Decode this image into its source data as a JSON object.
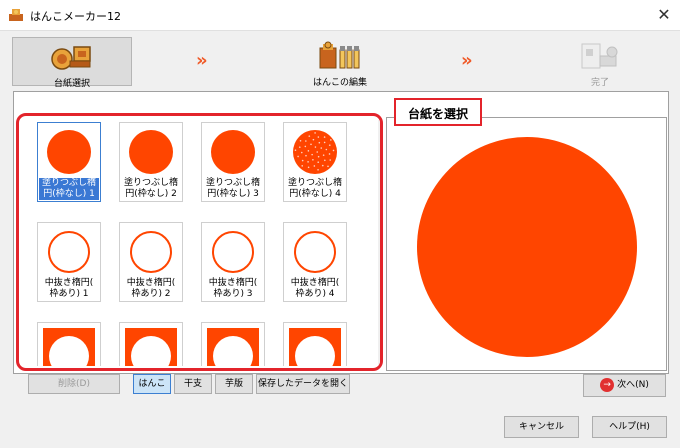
{
  "window": {
    "title": "はんこメーカー12",
    "close_glyph": "✕"
  },
  "steps": [
    {
      "label": "台紙選択",
      "icon": "stamp-base-icon",
      "active": true
    },
    {
      "label": "はんこの編集",
      "icon": "stamp-edit-icon",
      "active": false
    },
    {
      "label": "完了",
      "icon": "finish-icon",
      "active": false
    }
  ],
  "arrows": "»",
  "grid": {
    "items": [
      {
        "label": "塗りつぶし楕\n円(枠なし) 1",
        "style": "solid",
        "selected": true
      },
      {
        "label": "塗りつぶし楕\n円(枠なし) 2",
        "style": "solid",
        "selected": false
      },
      {
        "label": "塗りつぶし楕\n円(枠なし) 3",
        "style": "solid",
        "selected": false
      },
      {
        "label": "塗りつぶし楕\n円(枠なし) 4",
        "style": "speckled",
        "selected": false
      },
      {
        "label": "中抜き楕円(\n枠あり) 1",
        "style": "ring",
        "selected": false
      },
      {
        "label": "中抜き楕円(\n枠あり) 2",
        "style": "ring",
        "selected": false
      },
      {
        "label": "中抜き楕円(\n枠あり) 3",
        "style": "ring",
        "selected": false
      },
      {
        "label": "中抜き楕円(\n枠あり) 4",
        "style": "ring",
        "selected": false
      },
      {
        "label": "",
        "style": "square-hole",
        "selected": false
      },
      {
        "label": "",
        "style": "square-hole",
        "selected": false
      },
      {
        "label": "",
        "style": "square-hole",
        "selected": false
      },
      {
        "label": "",
        "style": "square-hole",
        "selected": false
      }
    ]
  },
  "scroll": {
    "up": "▲",
    "down": "▼"
  },
  "preview": {
    "label": "台紙を選択"
  },
  "buttons": {
    "delete": "削除(D)",
    "tab_hanko": "はんこ",
    "tab_kanshi": "干支",
    "tab_eto": "芋版",
    "open_saved": "保存したデータを開く",
    "next": "次へ(N)",
    "next_glyph": "→",
    "cancel": "キャンセル",
    "help": "ヘルプ(H)"
  },
  "colors": {
    "stamp_red": "#ff4500",
    "frame_red": "#e3242b",
    "selection_blue": "#3a78d4"
  }
}
